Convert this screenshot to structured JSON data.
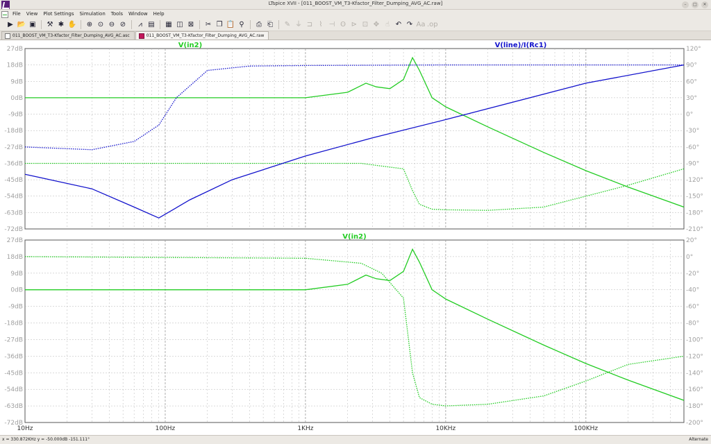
{
  "window": {
    "title": "LTspice XVII - [011_BOOST_VM_T3-Kfactor_Filter_Dumping_AVG_AC.raw]",
    "buttons": [
      "–",
      "□",
      "✕"
    ]
  },
  "menu": [
    "File",
    "View",
    "Plot Settings",
    "Simulation",
    "Tools",
    "Window",
    "Help"
  ],
  "toolbar_icons": [
    "run-icon",
    "open-icon",
    "save-icon",
    "control-panel-icon",
    "halt-icon",
    "pan-icon",
    "zoom-in-icon",
    "zoom-full-icon",
    "zoom-out-icon",
    "zoom-cancel-icon",
    "autorange-icon",
    "tile-icon",
    "cascade-icon",
    "close-window-icon",
    "print-icon",
    "print-setup-icon",
    "find-icon",
    "wire-icon",
    "ground-icon",
    "label-icon",
    "resistor-icon",
    "capacitor-icon",
    "inductor-icon",
    "diode-icon",
    "component-icon",
    "move-icon",
    "drag-icon",
    "undo-icon",
    "redo-icon",
    "text-icon",
    "spice-directive-icon"
  ],
  "tabs": [
    {
      "label": "011_BOOST_VM_T3-Kfactor_Filter_Dumping_AVG_AC.asc",
      "kind": "asc",
      "active": false
    },
    {
      "label": "011_BOOST_VM_T3-Kfactor_Filter_Dumping_AVG_AC.raw",
      "kind": "raw",
      "active": true
    }
  ],
  "status": {
    "coords": "x = 330.872KHz    y = -50.000dB  -151.111°",
    "mode": "Alternate"
  },
  "colors": {
    "green": "#22cc22",
    "blue": "#1111cc",
    "grid": "#b4b4b4",
    "axis_text": "#a0a0a0"
  },
  "chart_data": [
    {
      "type": "line",
      "x_scale": "log",
      "xlim": [
        10,
        500000
      ],
      "x_ticks": [
        "10Hz",
        "100Hz",
        "1KHz",
        "10KHz",
        "100KHz"
      ],
      "ylim_left": [
        -72,
        27
      ],
      "left_ticks": [
        "27dB",
        "18dB",
        "9dB",
        "0dB",
        "-9dB",
        "-18dB",
        "-27dB",
        "-36dB",
        "-45dB",
        "-54dB",
        "-63dB",
        "-72dB"
      ],
      "ylim_right": [
        -210,
        120
      ],
      "right_ticks": [
        "120°",
        "90°",
        "60°",
        "30°",
        "0°",
        "-30°",
        "-60°",
        "-90°",
        "-120°",
        "-150°",
        "-180°",
        "-210°"
      ],
      "grid": true,
      "trace_labels": [
        {
          "text": "V(in2)",
          "color": "#22cc22"
        },
        {
          "text": "V(line)/I(Rc1)",
          "color": "#1111cc"
        }
      ],
      "series": [
        {
          "name": "V(in2)",
          "color": "#22cc22",
          "style": "solid",
          "role": "magnitude",
          "x": [
            10,
            1000,
            2000,
            2700,
            3200,
            4000,
            5000,
            5800,
            6500,
            8000,
            10000,
            20000,
            50000,
            100000,
            200000,
            500000
          ],
          "y": [
            0,
            0,
            3,
            8,
            6,
            5,
            10,
            22,
            15,
            0,
            -5,
            -16,
            -30,
            -40,
            -49,
            -60
          ]
        },
        {
          "name": "V(in2)",
          "color": "#22cc22",
          "style": "dotted",
          "role": "phase",
          "x": [
            10,
            1000,
            2500,
            3500,
            5000,
            5800,
            6500,
            8000,
            10000,
            20000,
            50000,
            100000,
            200000,
            500000
          ],
          "y": [
            -90,
            -90,
            -90,
            -95,
            -100,
            -140,
            -165,
            -174,
            -175,
            -176,
            -170,
            -150,
            -130,
            -100
          ]
        },
        {
          "name": "V(line)/I(Rc1)",
          "color": "#1111cc",
          "style": "solid",
          "role": "magnitude",
          "x": [
            10,
            30,
            60,
            90,
            150,
            300,
            1000,
            3000,
            10000,
            100000,
            500000
          ],
          "y": [
            -42,
            -50,
            -60,
            -66,
            -56,
            -45,
            -32,
            -22,
            -12,
            8,
            18
          ]
        },
        {
          "name": "V(line)/I(Rc1)",
          "color": "#1111cc",
          "style": "dotted",
          "role": "phase",
          "x": [
            10,
            30,
            60,
            90,
            120,
            200,
            400,
            1000,
            10000,
            500000
          ],
          "y": [
            -60,
            -65,
            -50,
            -20,
            30,
            80,
            88,
            89,
            90,
            90
          ]
        }
      ]
    },
    {
      "type": "line",
      "x_scale": "log",
      "xlim": [
        10,
        500000
      ],
      "x_ticks": [
        "10Hz",
        "100Hz",
        "1KHz",
        "10KHz",
        "100KHz"
      ],
      "ylim_left": [
        -72,
        27
      ],
      "left_ticks": [
        "27dB",
        "18dB",
        "9dB",
        "0dB",
        "-9dB",
        "-18dB",
        "-27dB",
        "-36dB",
        "-45dB",
        "-54dB",
        "-63dB",
        "-72dB"
      ],
      "ylim_right": [
        -200,
        20
      ],
      "right_ticks": [
        "20°",
        "0°",
        "-20°",
        "-40°",
        "-60°",
        "-80°",
        "-100°",
        "-120°",
        "-140°",
        "-160°",
        "-180°",
        "-200°"
      ],
      "grid": true,
      "trace_labels": [
        {
          "text": "V(in2)",
          "color": "#22cc22"
        }
      ],
      "series": [
        {
          "name": "V(in2)",
          "color": "#22cc22",
          "style": "solid",
          "role": "magnitude",
          "x": [
            10,
            1000,
            2000,
            2700,
            3200,
            4000,
            5000,
            5800,
            6500,
            8000,
            10000,
            20000,
            50000,
            100000,
            200000,
            500000
          ],
          "y": [
            0,
            0,
            3,
            8,
            6,
            5,
            10,
            22,
            15,
            0,
            -5,
            -16,
            -30,
            -40,
            -49,
            -60
          ]
        },
        {
          "name": "V(in2)",
          "color": "#22cc22",
          "style": "dotted",
          "role": "phase",
          "x": [
            10,
            1000,
            2500,
            3500,
            5000,
            5800,
            6500,
            8000,
            10000,
            20000,
            50000,
            100000,
            200000,
            500000
          ],
          "y": [
            0,
            -2,
            -8,
            -20,
            -50,
            -140,
            -170,
            -178,
            -180,
            -178,
            -168,
            -150,
            -130,
            -120
          ]
        }
      ]
    }
  ]
}
